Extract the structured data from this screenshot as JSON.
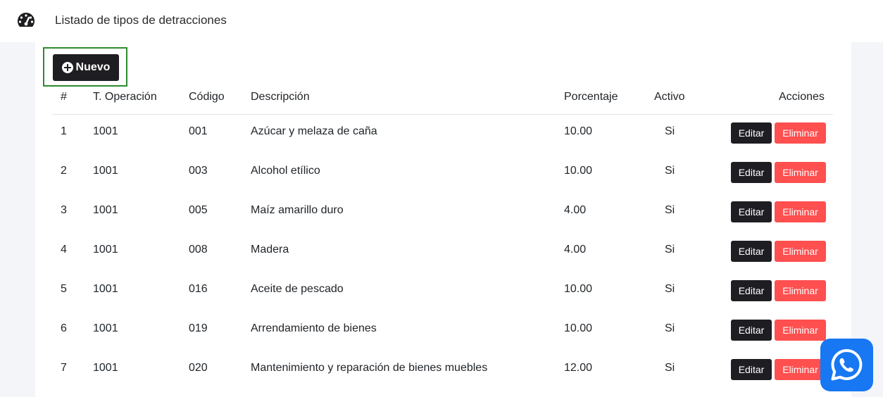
{
  "header": {
    "title": "Listado de tipos de detracciones",
    "icon": "dashboard-gauge-icon"
  },
  "toolbar": {
    "new_label": "Nuevo",
    "new_icon": "plus-circle-icon"
  },
  "table": {
    "columns": [
      "#",
      "T. Operación",
      "Código",
      "Descripción",
      "Porcentaje",
      "Activo",
      "Acciones"
    ],
    "rows": [
      {
        "num": "1",
        "op": "1001",
        "code": "001",
        "desc": "Azúcar y melaza de caña",
        "pct": "10.00",
        "active": "Si"
      },
      {
        "num": "2",
        "op": "1001",
        "code": "003",
        "desc": "Alcohol etílico",
        "pct": "10.00",
        "active": "Si"
      },
      {
        "num": "3",
        "op": "1001",
        "code": "005",
        "desc": "Maíz amarillo duro",
        "pct": "4.00",
        "active": "Si"
      },
      {
        "num": "4",
        "op": "1001",
        "code": "008",
        "desc": "Madera",
        "pct": "4.00",
        "active": "Si"
      },
      {
        "num": "5",
        "op": "1001",
        "code": "016",
        "desc": "Aceite de pescado",
        "pct": "10.00",
        "active": "Si"
      },
      {
        "num": "6",
        "op": "1001",
        "code": "019",
        "desc": "Arrendamiento de bienes",
        "pct": "10.00",
        "active": "Si"
      },
      {
        "num": "7",
        "op": "1001",
        "code": "020",
        "desc": "Mantenimiento y reparación de bienes muebles",
        "pct": "12.00",
        "active": "Si"
      }
    ],
    "edit_label": "Editar",
    "delete_label": "Eliminar"
  },
  "floating": {
    "whatsapp_icon": "whatsapp-icon"
  },
  "colors": {
    "dark_button": "#1e1e22",
    "danger_button": "#ff4f4f",
    "whatsapp_bg": "#1877f2",
    "highlight_border": "#2e8b2e"
  }
}
